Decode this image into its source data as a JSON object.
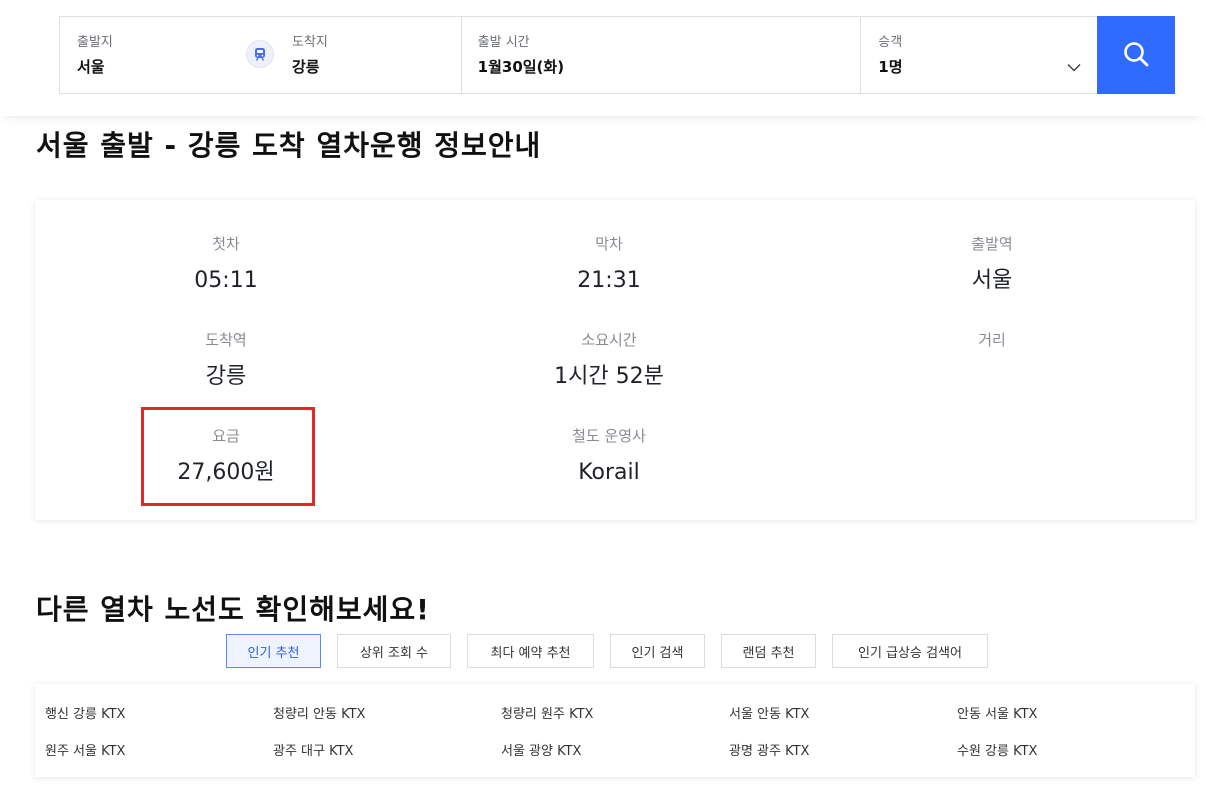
{
  "search": {
    "departure_label": "출발지",
    "departure_value": "서울",
    "arrival_label": "도착지",
    "arrival_value": "강릉",
    "time_label": "출발 시간",
    "time_value": "1월30일(화)",
    "passenger_label": "승객",
    "passenger_value": "1명"
  },
  "page_title": "서울 출발 - 강릉 도착 열차운행 정보안내",
  "info": {
    "first_train_label": "첫차",
    "first_train_value": "05:11",
    "last_train_label": "막차",
    "last_train_value": "21:31",
    "departure_station_label": "출발역",
    "departure_station_value": "서울",
    "arrival_station_label": "도착역",
    "arrival_station_value": "강릉",
    "duration_label": "소요시간",
    "duration_value": "1시간 52분",
    "distance_label": "거리",
    "fare_label": "요금",
    "fare_value": "27,600원",
    "operator_label": "철도 운영사",
    "operator_value": "Korail"
  },
  "other_routes_title": "다른 열차 노선도 확인해보세요!",
  "tabs": [
    {
      "label": "인기 추천",
      "active": true
    },
    {
      "label": "상위 조회 수"
    },
    {
      "label": "최다 예약 추천"
    },
    {
      "label": "인기 검색"
    },
    {
      "label": "랜덤 추천"
    },
    {
      "label": "인기 급상승 검색어"
    }
  ],
  "routes": [
    "행신 강릉 KTX",
    "청량리 안동 KTX",
    "청량리 원주 KTX",
    "서울 안동 KTX",
    "안동 서울 KTX",
    "원주 서울 KTX",
    "광주 대구 KTX",
    "서울 광양 KTX",
    "광명 광주 KTX",
    "수원 강릉 KTX"
  ],
  "colors": {
    "accent": "#2f6bff",
    "highlight": "#e3262b"
  },
  "icons": {
    "swap": "train-icon",
    "dropdown": "chevron-down-icon",
    "search": "search-icon"
  }
}
